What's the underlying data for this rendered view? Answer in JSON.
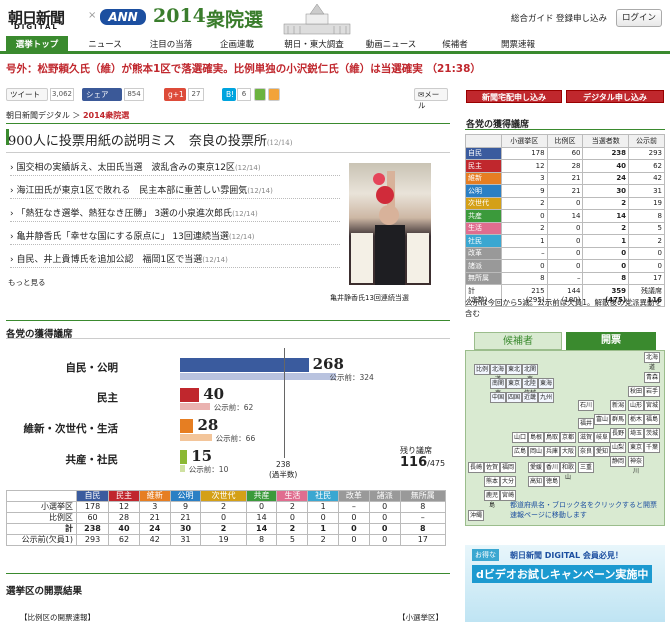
{
  "header": {
    "logo_main": "朝日新聞",
    "logo_sub": "DIGITAL",
    "logo_x": "×",
    "logo_ann": "ANN",
    "logo_year": "2014",
    "logo_title": "衆院選",
    "nav_guide": "総合ガイド",
    "nav_register": "登録申し込み",
    "login": "ログイン"
  },
  "menu": [
    "選挙トップ",
    "ニュース",
    "注目の当落",
    "企画連載",
    "朝日・東大調査",
    "動画ニュース",
    "候補者",
    "開票速報"
  ],
  "breaking": "号外：松野頼久氏（維）が熊本1区で落選確実。比例単独の小沢鋭仁氏（維）は当選確実 （21:38）",
  "share": {
    "tweet": "ツイート",
    "tweet_count": "3,062",
    "fb": "シェア",
    "fb_count": "854",
    "gplus": "g+1",
    "gplus_count": "27",
    "hatena": "B!",
    "hatena_count": "6",
    "mail": "メール"
  },
  "breadcrumb": {
    "site": "朝日新聞デジタル",
    "sep": "＞",
    "current": "2014衆院選"
  },
  "lead": {
    "title": "900人に投票用紙の説明ミス　奈良の投票所",
    "date": "(12/14)"
  },
  "news": [
    {
      "title": "国交相の実績訴え、太田氏当選　波乱含みの東京12区",
      "date": "(12/14)"
    },
    {
      "title": "海江田氏が東京1区で敗れる　民主本部に重苦しい雰囲気",
      "date": "(12/14)"
    },
    {
      "title": "「熱狂なき選挙、熱狂なき圧勝」 3選の小泉進次郎氏",
      "date": "(12/14)"
    },
    {
      "title": "亀井静香氏「幸せな国にする原点に」 13回連続当選",
      "date": "(12/14)"
    },
    {
      "title": "自民、井上貴博氏を追加公認　福岡1区で当選",
      "date": "(12/14)"
    }
  ],
  "more": "もっと見る",
  "photo_caption": "亀井静香氏13回連続当選",
  "order_buttons": [
    "新聞宅配申し込み",
    "デジタル申し込み"
  ],
  "party_table": {
    "title": "各党の獲得議席",
    "headers": [
      "",
      "小選挙区",
      "比例区",
      "当選者数",
      "公示前"
    ],
    "rows": [
      [
        "自民",
        "178",
        "60",
        "238",
        "293"
      ],
      [
        "民主",
        "12",
        "28",
        "40",
        "62"
      ],
      [
        "維新",
        "3",
        "21",
        "24",
        "42"
      ],
      [
        "公明",
        "9",
        "21",
        "30",
        "31"
      ],
      [
        "次世代",
        "2",
        "0",
        "2",
        "19"
      ],
      [
        "共産",
        "0",
        "14",
        "14",
        "8"
      ],
      [
        "生活",
        "2",
        "0",
        "2",
        "5"
      ],
      [
        "社民",
        "1",
        "0",
        "1",
        "2"
      ],
      [
        "改革",
        "–",
        "0",
        "0",
        "0"
      ],
      [
        "諸派",
        "0",
        "0",
        "0",
        "0"
      ],
      [
        "無所属",
        "8",
        "–",
        "8",
        "17"
      ]
    ],
    "total": {
      "label": "計",
      "sub": "(定数)",
      "smd": "215",
      "smd_sub": "(295)",
      "pr": "144",
      "pr_sub": "(180)",
      "won": "359",
      "won_sub": "(475)",
      "remain_label": "残議席",
      "remain": "116"
    },
    "note": "公示は今回から5減。公示前は欠員1。解散後の党派異動を含む",
    "colors": [
      "#3a5b9e",
      "#c0272d",
      "#e67e22",
      "#2a7fc4",
      "#d4a017",
      "#3b9a3b",
      "#e06d8f",
      "#3aa7d1",
      "#999999",
      "#999999",
      "#999999"
    ]
  },
  "seats": {
    "title": "各党の獲得議席",
    "groups": [
      {
        "label": "自民・公明",
        "value": "268",
        "prev_label": "公示前：",
        "prev": "324",
        "color": "#3a5b9e",
        "prev_color": "#b9c3df"
      },
      {
        "label": "民主",
        "value": "40",
        "prev_label": "公示前：",
        "prev": "62",
        "color": "#c0272d",
        "prev_color": "#eab2b0"
      },
      {
        "label": "維新・次世代・生活",
        "value": "28",
        "prev_label": "公示前：",
        "prev": "66",
        "color": "#e67e22",
        "prev_color": "#f3c59a"
      },
      {
        "label": "共産・社民",
        "value": "15",
        "prev_label": "公示前：",
        "prev": "10",
        "color": "#8bb833",
        "prev_color": "#cfe1a1"
      }
    ],
    "majority": "238",
    "majority_sub": "(過半数)",
    "remain_label": "残り議席",
    "remain": "116",
    "remain_total": "/475"
  },
  "bottom_table": {
    "headers": [
      "",
      "自民",
      "民主",
      "維新",
      "公明",
      "次世代",
      "共産",
      "生活",
      "社民",
      "改革",
      "諸派",
      "無所属"
    ],
    "colors": [
      "#fff",
      "#3a5b9e",
      "#c0272d",
      "#e67e22",
      "#2a7fc4",
      "#d4a017",
      "#3b9a3b",
      "#e06d8f",
      "#3aa7d1",
      "#999",
      "#999",
      "#999"
    ],
    "rows": [
      [
        "小選挙区",
        "178",
        "12",
        "3",
        "9",
        "2",
        "0",
        "2",
        "1",
        "–",
        "0",
        "8"
      ],
      [
        "比例区",
        "60",
        "28",
        "21",
        "21",
        "0",
        "14",
        "0",
        "0",
        "0",
        "0",
        "–"
      ],
      [
        "計",
        "238",
        "40",
        "24",
        "30",
        "2",
        "14",
        "2",
        "1",
        "0",
        "0",
        "8"
      ],
      [
        "公示前(欠員1)",
        "293",
        "62",
        "42",
        "31",
        "19",
        "8",
        "5",
        "2",
        "0",
        "0",
        "17"
      ]
    ]
  },
  "districts": {
    "title": "選挙区の開票結果",
    "left": "【比例区の開票速報】",
    "right": "【小選挙区】"
  },
  "map": {
    "tab_candidates": "候補者",
    "tab_results": "開票",
    "prefs": [
      "北海道",
      "青森",
      "秋田",
      "岩手",
      "山形",
      "宮城",
      "新潟",
      "福島",
      "群馬",
      "栃木",
      "茨城",
      "石川",
      "富山",
      "長野",
      "埼玉",
      "千葉",
      "山口",
      "島根",
      "鳥取",
      "京都",
      "滋賀",
      "岐阜",
      "山梨",
      "東京",
      "広島",
      "岡山",
      "兵庫",
      "大阪",
      "奈良",
      "愛知",
      "静岡",
      "神奈川",
      "長崎",
      "佐賀",
      "福岡",
      "愛媛",
      "香川",
      "和歌山",
      "三重",
      "熊本",
      "大分",
      "高知",
      "徳島",
      "鹿児島",
      "宮崎",
      "沖縄",
      "福井"
    ],
    "blocks": [
      "北海道",
      "東北",
      "北関東",
      "南関東",
      "東京",
      "北陸信越",
      "東海",
      "近畿",
      "中国",
      "四国",
      "九州",
      "比例"
    ],
    "note": "都道府県名・ブロック名をクリックすると開票速報ページに移動します"
  },
  "ad": {
    "badge": "お得な",
    "line1": "朝日新聞 DIGITAL 会員必見！",
    "line2": "dビデオお試しキャンペーン実施中"
  }
}
